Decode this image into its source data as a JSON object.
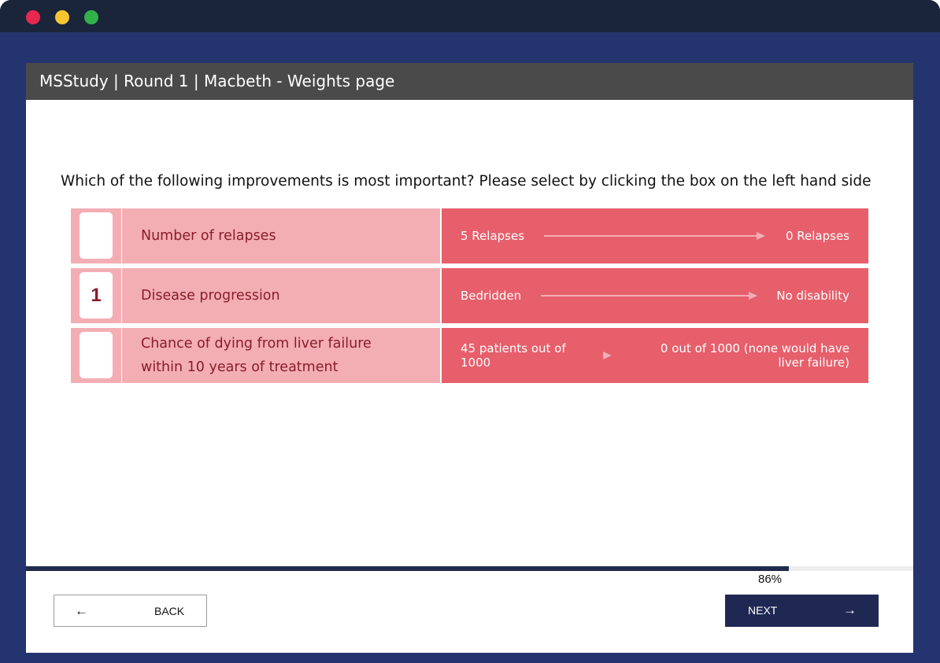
{
  "colors": {
    "frame": "#23346f",
    "titlebar": "#1a253a",
    "header": "#4a4a4a",
    "row_light": "#f3aeb4",
    "row_dark": "#e65f6b",
    "text_dark_red": "#8a1c2a",
    "button_dark": "#1f2753",
    "progress": "#1f2a4d"
  },
  "window_controls": [
    "close-dot",
    "minimize-dot",
    "maximize-dot"
  ],
  "header": {
    "title": "MSStudy | Round 1 | Macbeth - Weights page"
  },
  "question": "Which of the following improvements is most important? Please select by clicking the box on the left hand side",
  "rows": [
    {
      "rank": "",
      "label_line1": "Number of relapses",
      "label_line2": "",
      "from": "5 Relapses",
      "to": "0 Relapses"
    },
    {
      "rank": "1",
      "label_line1": "Disease progression",
      "label_line2": "",
      "from": "Bedridden",
      "to": "No disability"
    },
    {
      "rank": "",
      "label_line1": "Chance of dying from liver failure",
      "label_line2": "within 10 years of treatment",
      "from_line1": "45 patients out of",
      "from_line2": "1000",
      "to_line1": "0 out of 1000 (none would have",
      "to_line2": "liver failure)"
    }
  ],
  "progress": {
    "value": 0.86,
    "label": "86%"
  },
  "nav": {
    "back_label": "BACK",
    "back_icon": "arrow-left-icon",
    "next_label": "NEXT",
    "next_icon": "arrow-right-icon"
  }
}
